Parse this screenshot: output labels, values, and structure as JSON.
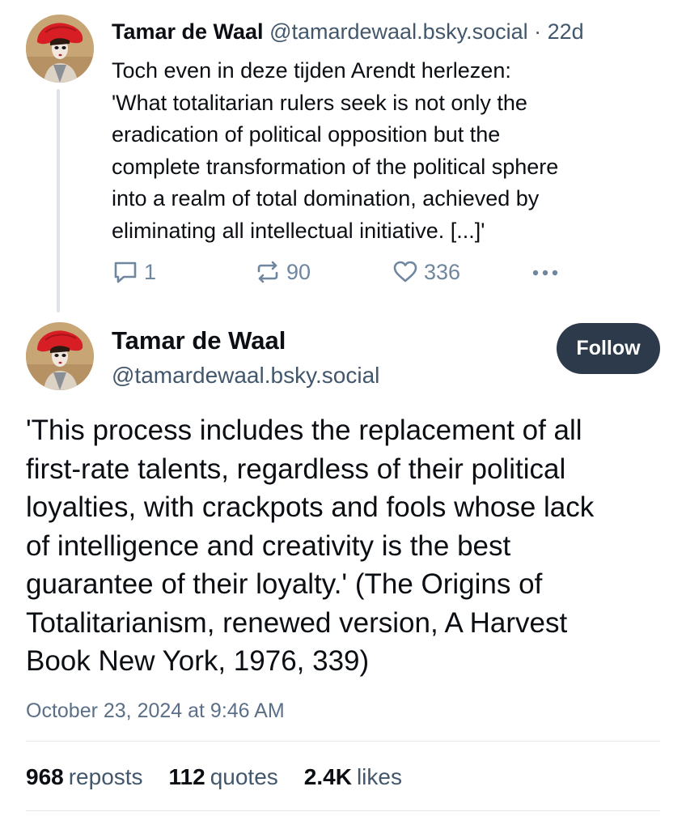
{
  "parent_post": {
    "author_name": "Tamar de Waal",
    "handle_meta": " @tamardewaal.bsky.social · 22d",
    "text": "Toch even in deze tijden Arendt herlezen:\n'What totalitarian rulers seek is not only the\neradication of political opposition but the\ncomplete transformation of the political sphere\ninto a realm of total domination, achieved by\neliminating all intellectual initiative. [...]'",
    "reply_count": "1",
    "repost_count": "90",
    "like_count": "336",
    "icons": [
      "reply-icon",
      "repost-icon",
      "like-icon",
      "more-icon"
    ]
  },
  "main_post": {
    "author_name": "Tamar de Waal",
    "handle": "@tamardewaal.bsky.social",
    "follow_label": "Follow",
    "text": "'This process includes the replacement of all\nfirst-rate talents, regardless of their political\nloyalties, with crackpots and fools whose lack\nof intelligence and creativity is the best\nguarantee of their loyalty.' (The Origins of\nTotalitarianism, renewed version, A Harvest\nBook New York, 1976, 339)",
    "timestamp": "October 23, 2024 at 9:46 AM",
    "stats": {
      "reposts_num": "968",
      "reposts_label": "reposts",
      "quotes_num": "112",
      "quotes_label": "quotes",
      "likes_num": "2.4K",
      "likes_label": "likes"
    }
  },
  "colors": {
    "text_primary": "#0b0f14",
    "text_secondary": "#42576c",
    "icon_muted": "#6f869f",
    "follow_button_bg": "#2c3a4b",
    "divider": "#e4e8ec"
  }
}
